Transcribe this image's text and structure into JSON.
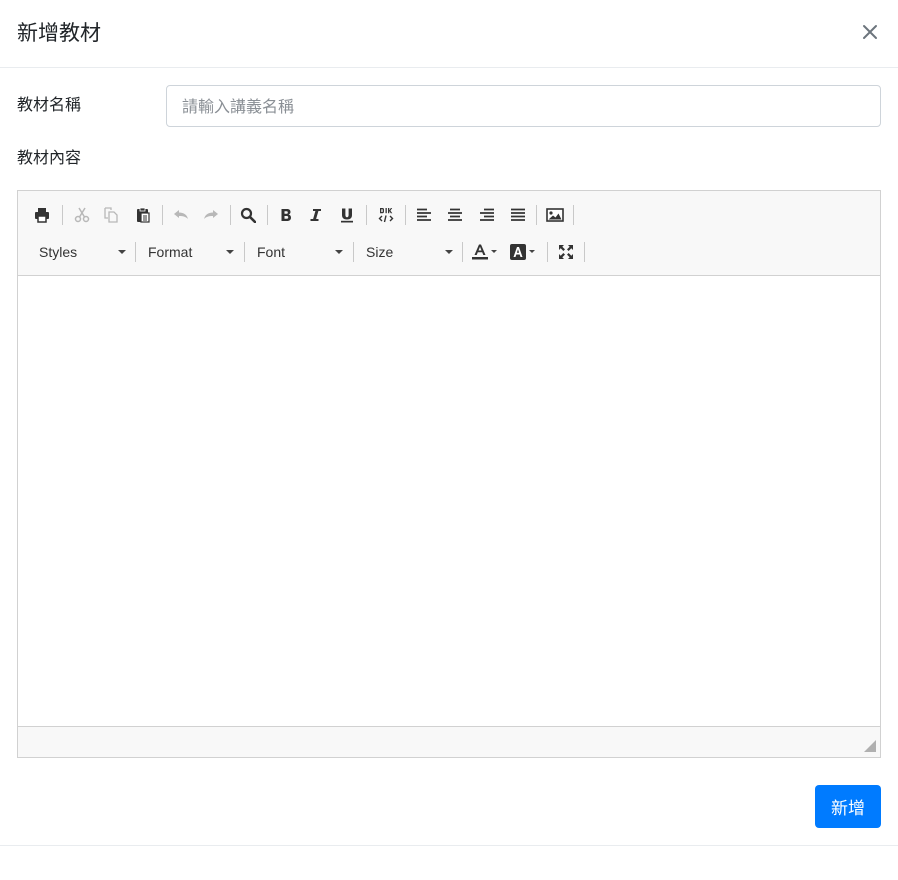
{
  "dialog": {
    "title": "新增教材",
    "close_icon": "close-icon"
  },
  "form": {
    "name_label": "教材名稱",
    "name_placeholder": "請輸入講義名稱",
    "name_value": "",
    "content_label": "教材內容"
  },
  "editor": {
    "toolbar_row1": [
      "print-icon",
      "cut-icon",
      "copy-icon",
      "paste-icon",
      "undo-icon",
      "redo-icon",
      "find-icon",
      "bold-icon",
      "italic-icon",
      "underline-icon",
      "source-icon",
      "align-left-icon",
      "align-center-icon",
      "align-right-icon",
      "justify-icon",
      "image-icon"
    ],
    "combos": {
      "styles": "Styles",
      "format": "Format",
      "font": "Font",
      "size": "Size"
    },
    "toolbar_row2_icons": [
      "text-color-icon",
      "background-color-icon",
      "maximize-icon"
    ],
    "content": ""
  },
  "actions": {
    "submit_label": "新增"
  },
  "colors": {
    "primary": "#007bff",
    "toolbar_bg": "#f8f8f8",
    "border": "#d1d1d1"
  }
}
